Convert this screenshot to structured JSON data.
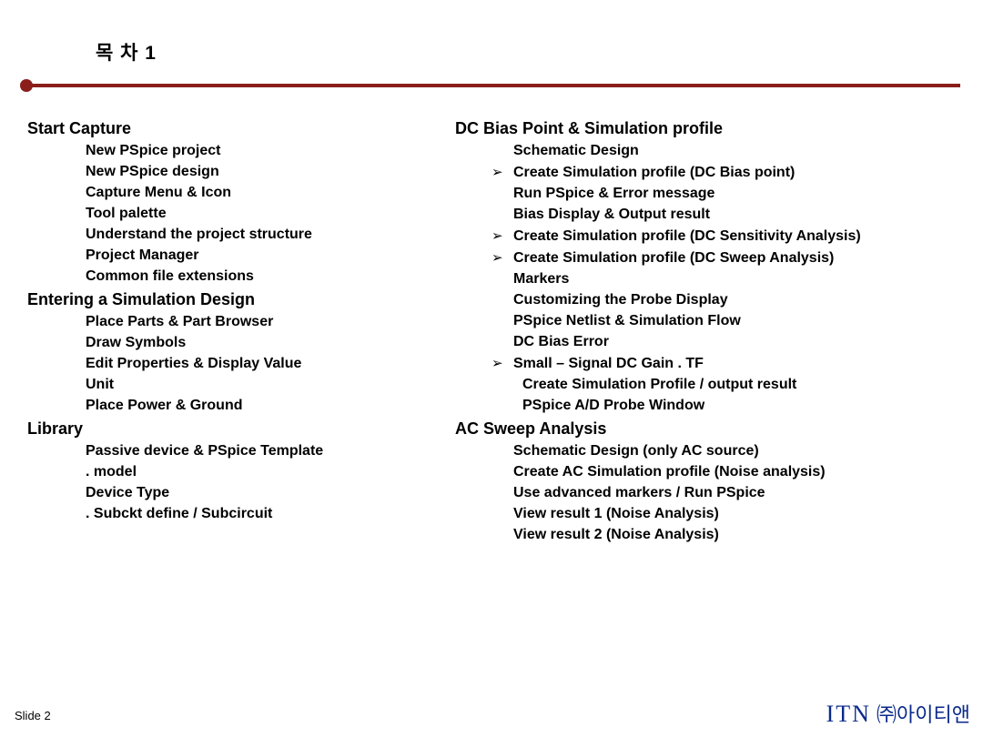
{
  "header": {
    "title": "목     차 1"
  },
  "left": {
    "sections": [
      {
        "title": "Start Capture",
        "items": [
          {
            "bullet": "",
            "text": "New PSpice project",
            "indent": 1
          },
          {
            "bullet": "",
            "text": "New PSpice design",
            "indent": 1
          },
          {
            "bullet": "",
            "text": "Capture Menu & Icon",
            "indent": 1
          },
          {
            "bullet": "",
            "text": "Tool palette",
            "indent": 1
          },
          {
            "bullet": "",
            "text": "Understand the project structure",
            "indent": 1
          },
          {
            "bullet": "",
            "text": "Project Manager",
            "indent": 1
          },
          {
            "bullet": "",
            "text": "Common file extensions",
            "indent": 1
          }
        ]
      },
      {
        "title": "Entering a Simulation Design",
        "items": [
          {
            "bullet": "",
            "text": "Place Parts & Part Browser",
            "indent": 1
          },
          {
            "bullet": "",
            "text": "Draw Symbols",
            "indent": 1
          },
          {
            "bullet": "",
            "text": "Edit Properties & Display Value",
            "indent": 1
          },
          {
            "bullet": "",
            "text": "Unit",
            "indent": 1
          },
          {
            "bullet": "",
            "text": "Place Power & Ground",
            "indent": 1
          }
        ]
      },
      {
        "title": "Library",
        "items": [
          {
            "bullet": "",
            "text": "Passive device & PSpice Template",
            "indent": 1
          },
          {
            "bullet": "",
            "text": ". model",
            "indent": 1
          },
          {
            "bullet": "",
            "text": "Device Type",
            "indent": 1
          },
          {
            "bullet": "",
            "text": ". Subckt define / Subcircuit",
            "indent": 1
          }
        ]
      }
    ]
  },
  "right": {
    "sections": [
      {
        "title": "DC Bias Point & Simulation profile",
        "items": [
          {
            "bullet": "",
            "text": "Schematic Design",
            "indent": 1
          },
          {
            "bullet": "➢",
            "text": "Create Simulation profile (DC Bias point)",
            "indent": 1
          },
          {
            "bullet": "",
            "text": "Run PSpice & Error message",
            "indent": 1
          },
          {
            "bullet": "",
            "text": "Bias Display & Output result",
            "indent": 1
          },
          {
            "bullet": "➢",
            "text": "Create Simulation profile (DC Sensitivity Analysis)",
            "indent": 1
          },
          {
            "bullet": "➢",
            "text": "Create Simulation profile (DC Sweep Analysis)",
            "indent": 1
          },
          {
            "bullet": "",
            "text": "Markers",
            "indent": 1
          },
          {
            "bullet": "",
            "text": "Customizing the Probe Display",
            "indent": 1
          },
          {
            "bullet": "",
            "text": "PSpice Netlist & Simulation Flow",
            "indent": 1
          },
          {
            "bullet": "",
            "text": "DC Bias Error",
            "indent": 1
          },
          {
            "bullet": "➢",
            "text": "Small – Signal DC Gain  . TF",
            "indent": 1
          },
          {
            "bullet": "",
            "text": "Create Simulation Profile / output result",
            "indent": 2
          },
          {
            "bullet": "",
            "text": "PSpice A/D Probe Window",
            "indent": 2
          }
        ]
      },
      {
        "title": "AC Sweep Analysis",
        "items": [
          {
            "bullet": "",
            "text": "Schematic Design (only AC source)",
            "indent": 1
          },
          {
            "bullet": "",
            "text": "Create AC Simulation profile (Noise analysis)",
            "indent": 1
          },
          {
            "bullet": "",
            "text": "Use advanced markers / Run PSpice",
            "indent": 1
          },
          {
            "bullet": "",
            "text": "View result 1 (Noise Analysis)",
            "indent": 1
          },
          {
            "bullet": "",
            "text": "View result 2 (Noise Analysis)",
            "indent": 1
          }
        ]
      }
    ]
  },
  "footer": {
    "left": "Slide 2",
    "right_brand": "ITN",
    "right_company": "㈜아이티앤"
  }
}
